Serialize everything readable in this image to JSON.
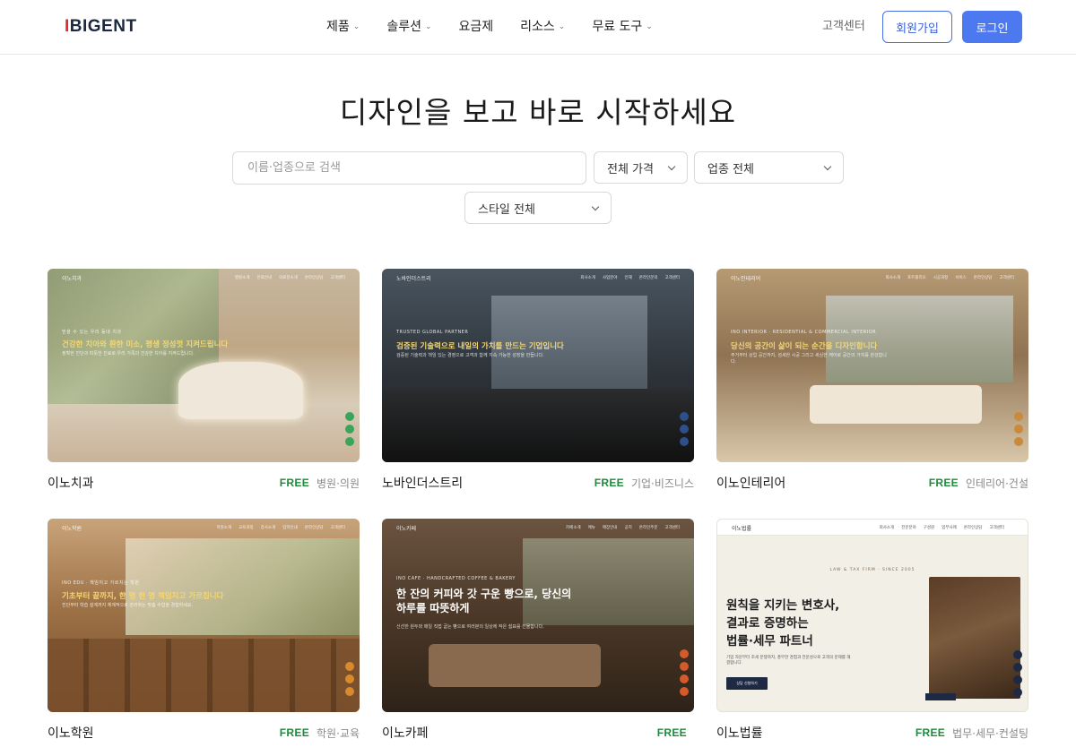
{
  "header": {
    "logo_first": "I",
    "logo_rest": "BIGENT",
    "nav": [
      {
        "label": "제품",
        "has_caret": true
      },
      {
        "label": "솔루션",
        "has_caret": true
      },
      {
        "label": "요금제",
        "has_caret": false
      },
      {
        "label": "리소스",
        "has_caret": true
      },
      {
        "label": "무료 도구",
        "has_caret": true
      }
    ],
    "caret_glyph": "⌄",
    "support": "고객센터",
    "signup": "회원가입",
    "login": "로그인"
  },
  "hero": {
    "title": "디자인을 보고 바로 시작하세요"
  },
  "filters": {
    "search_placeholder": "이름·업종으로 검색",
    "price": "전체 가격",
    "industry": "업종 전체",
    "style": "스타일 전체"
  },
  "colors": {
    "accent": "#4c78f0",
    "free": "#1f8a3c",
    "logo_red": "#e02b2b",
    "logo_navy": "#1b2840"
  },
  "cards": [
    {
      "name": "이노치과",
      "price": "FREE",
      "category": "병원·의원",
      "thumb": {
        "eyebrow": "믿을 수 있는 우리 동네 치과",
        "headline": "건강한 치아와 환한 미소, 평생 정성껏 지켜드립니다",
        "body": "정확한 진단과 따뜻한 진료로 우리 가족의 건강한 치아를 지켜드립니다.",
        "logo": "이노치과",
        "links": [
          "병원소개",
          "진료안내",
          "의료진소개",
          "온라인상담",
          "고객센터"
        ]
      }
    },
    {
      "name": "노바인더스트리",
      "price": "FREE",
      "category": "기업·비즈니스",
      "thumb": {
        "eyebrow": "TRUSTED GLOBAL PARTNER",
        "headline": "검증된 기술력으로 내일의 가치를 만드는 기업입니다",
        "body": "검증된 기술력과 책임 있는 경영으로 고객과 함께 지속 가능한 성장을 만듭니다.",
        "logo": "노바인더스트리",
        "links": [
          "회사소개",
          "사업분야",
          "인재",
          "온라인문의",
          "고객센터"
        ]
      }
    },
    {
      "name": "이노인테리어",
      "price": "FREE",
      "category": "인테리어·건설",
      "thumb": {
        "eyebrow": "INO INTERIOR · RESIDENTIAL & COMMERCIAL INTERIOR",
        "headline": "당신의 공간이 삶이 되는 순간을 디자인합니다",
        "body": "주거부터 상업 공간까지, 섬세한 시공 그리고 세심한 케어로 공간의 가치를 완성합니다.",
        "logo": "이노인테리어",
        "links": [
          "회사소개",
          "포트폴리오",
          "시공과정",
          "서비스",
          "온라인상담",
          "고객센터"
        ]
      }
    },
    {
      "name": "이노학원",
      "price": "FREE",
      "category": "학원·교육",
      "thumb": {
        "eyebrow": "INO EDU · 책임지고 가르치는 학원",
        "headline": "기초부터 끝까지, 한 명 한 명 책임지고 가르칩니다",
        "body": "진단부터 학습 설계까지 체계적으로 관리하는 맞춤 수업을 경험하세요.",
        "logo": "이노학원",
        "links": [
          "학원소개",
          "교육과정",
          "강사소개",
          "입학안내",
          "온라인상담",
          "고객센터"
        ]
      }
    },
    {
      "name": "이노카페",
      "price": "FREE",
      "category": "",
      "thumb": {
        "eyebrow": "INO CAFE · HANDCRAFTED COFFEE & BAKERY",
        "headline": "한 잔의 커피와 갓 구운 빵으로, 당신의 하루를 따뜻하게",
        "body": "신선한 원두와 매일 직접 굽는 빵으로 여러분의 일상에 작은 쉼표를 선물합니다.",
        "logo": "이노카페",
        "links": [
          "카페소개",
          "메뉴",
          "매장안내",
          "공지",
          "온라인주문",
          "고객센터"
        ]
      }
    },
    {
      "name": "이노법률",
      "price": "FREE",
      "category": "법무·세무·컨설팅",
      "thumb": {
        "eyebrow": "LAW & TAX FIRM · SINCE 2005",
        "headline_line1": "원칙을 지키는 변호사,",
        "headline_line2": "결과로 증명하는",
        "headline_line3": "법률·세무 파트너",
        "body": "기업 자문부터 조세 분쟁까지, 풍부한 경험과 전문성으로 고객의 문제를 해결합니다.",
        "cta": "상담 신청하기",
        "logo": "이노법률",
        "links": [
          "회사소개",
          "전문분야",
          "구성원",
          "업무사례",
          "온라인상담",
          "고객센터"
        ]
      }
    }
  ]
}
